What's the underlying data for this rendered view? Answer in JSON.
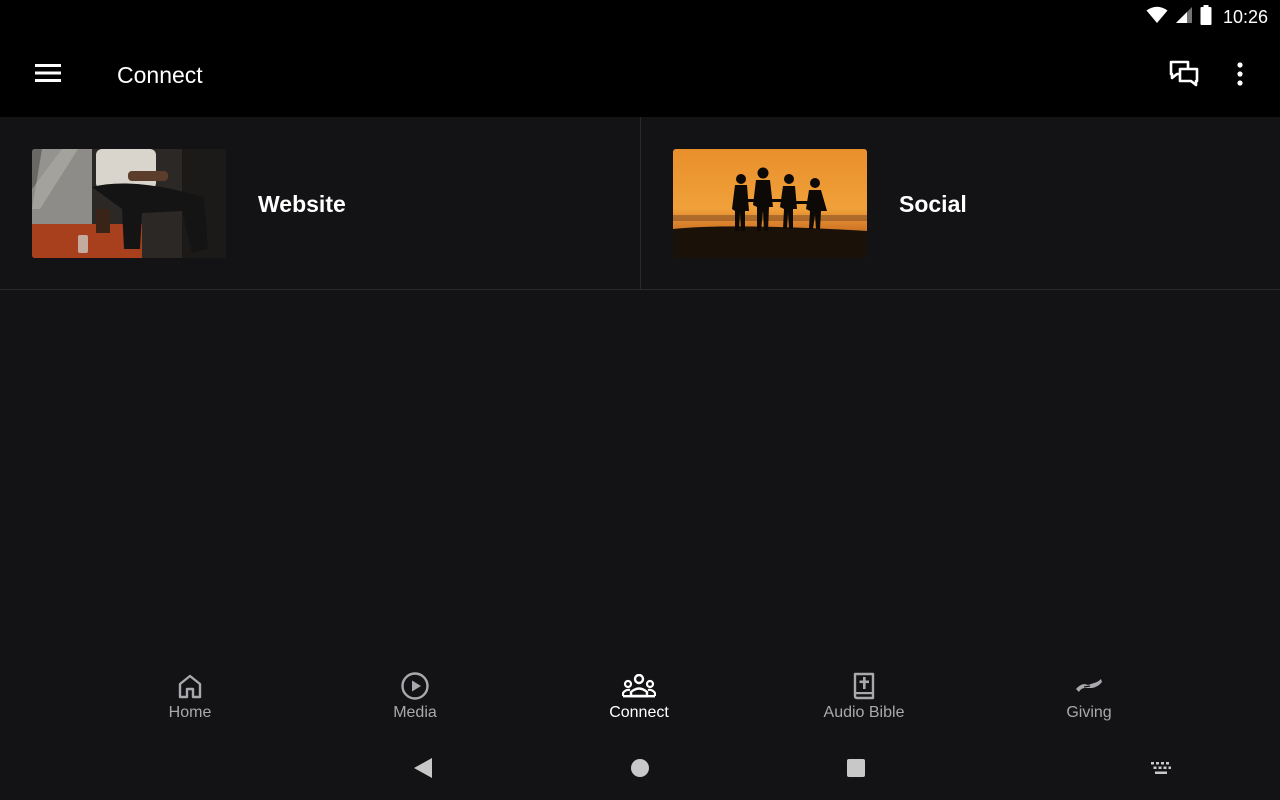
{
  "status_bar": {
    "time": "10:26"
  },
  "app_bar": {
    "title": "Connect"
  },
  "tiles": [
    {
      "label": "Website",
      "image": "person-seated-photo"
    },
    {
      "label": "Social",
      "image": "sunset-silhouettes-photo"
    }
  ],
  "bottom_nav": {
    "active": "Connect",
    "items": [
      {
        "label": "Home",
        "icon": "home-icon"
      },
      {
        "label": "Media",
        "icon": "play-circle-icon"
      },
      {
        "label": "Connect",
        "icon": "group-icon"
      },
      {
        "label": "Audio Bible",
        "icon": "bible-icon"
      },
      {
        "label": "Giving",
        "icon": "giving-hand-icon"
      }
    ]
  },
  "colors": {
    "background": "#131315",
    "bar": "#000000",
    "inactive_label": "#a9a9ad",
    "active_label": "#ffffff"
  }
}
